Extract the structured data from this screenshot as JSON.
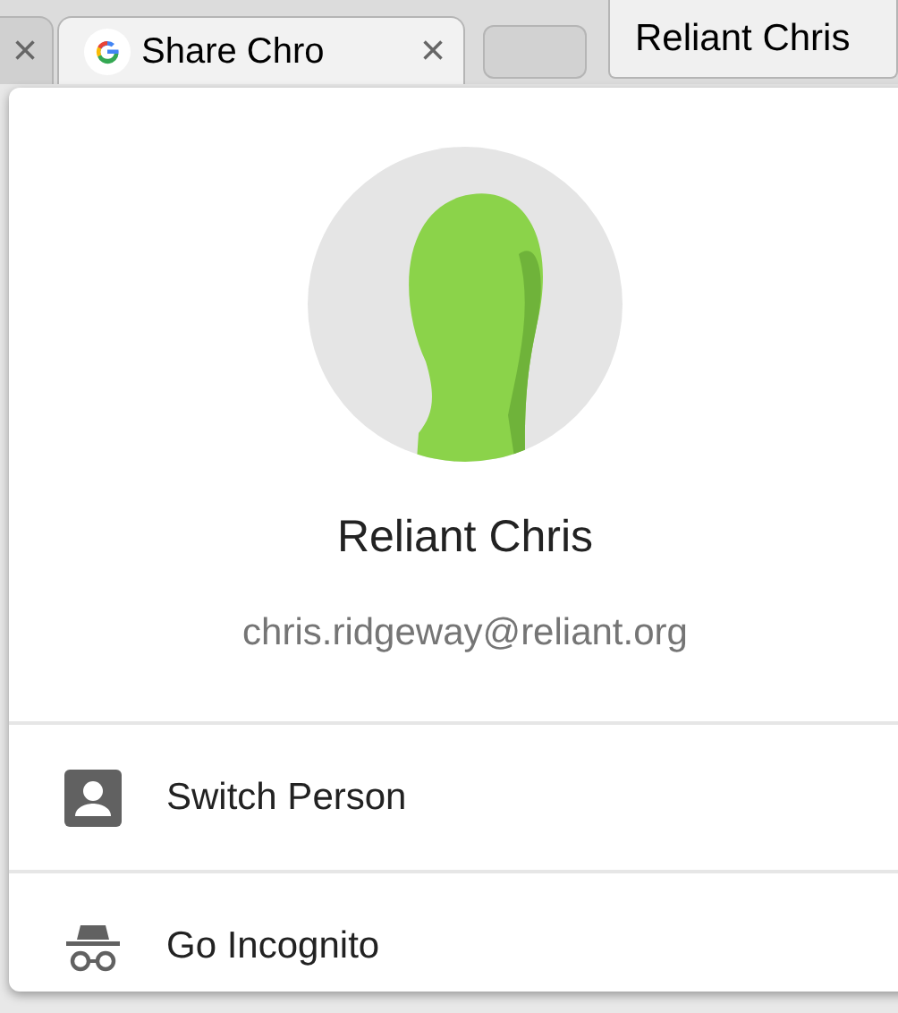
{
  "tabs": [
    {
      "close": "×",
      "selected": false
    },
    {
      "label": "Share Chro",
      "close": "×",
      "selected": true
    }
  ],
  "profile_button": {
    "label": "Reliant Chris"
  },
  "menu": {
    "name": "Reliant Chris",
    "email": "chris.ridgeway@reliant.org",
    "items": [
      {
        "kind": "person",
        "label": "Switch Person"
      },
      {
        "kind": "incognito",
        "label": "Go Incognito"
      }
    ]
  }
}
